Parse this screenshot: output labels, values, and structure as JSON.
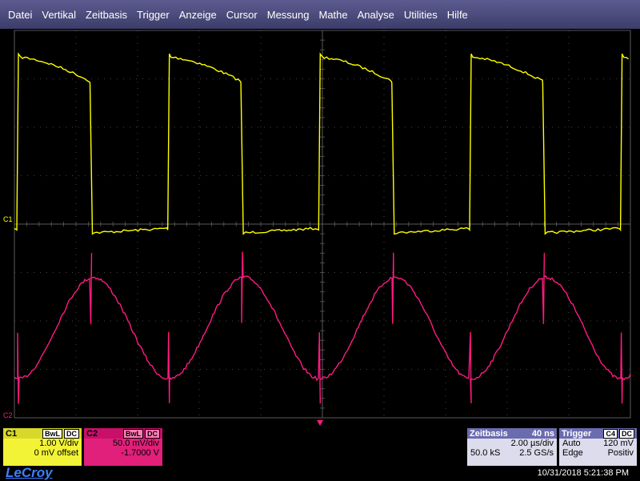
{
  "menu": [
    "Datei",
    "Vertikal",
    "Zeitbasis",
    "Trigger",
    "Anzeige",
    "Cursor",
    "Messung",
    "Mathe",
    "Analyse",
    "Utilities",
    "Hilfe"
  ],
  "colors": {
    "ch1": "#ffff00",
    "ch2": "#ff1a80",
    "grid": "#5a5a5a",
    "accent": "#6b6bb0",
    "logo": "#3f7fff"
  },
  "markers": {
    "c1": "C1",
    "c2": "C2"
  },
  "c1": {
    "label": "C1",
    "tag1": "BwL",
    "tag2": "DC",
    "scale": "1.00 V/div",
    "offset": "0 mV offset"
  },
  "c2": {
    "label": "C2",
    "tag1": "BwL",
    "tag2": "DC",
    "scale": "50.0 mV/div",
    "offset": "-1.7000 V"
  },
  "timebase": {
    "title": "Zeitbasis",
    "delay": "40 ns",
    "per_div": "2.00 µs/div",
    "samples": "50.0 kS",
    "rate": "2.5 GS/s"
  },
  "trigger": {
    "title": "Trigger",
    "source": "C4",
    "coupling": "DC",
    "mode": "Auto",
    "level": "120 mV",
    "type": "Edge",
    "slope": "Positiv"
  },
  "brand": "LeCroy",
  "datetime": "10/31/2018 5:21:38 PM",
  "waveform": {
    "period_div": 2.45,
    "ch1": {
      "high_start_div": 3.45,
      "high_end_div": 2.95,
      "low_div": -0.12
    },
    "ch2": {
      "center_div": -2.15,
      "amplitude_div": 1.05
    }
  }
}
